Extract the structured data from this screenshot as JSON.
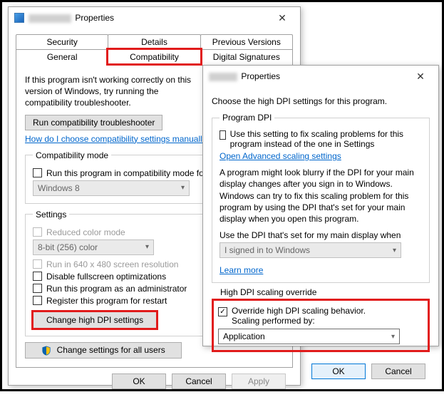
{
  "dlg1": {
    "title_suffix": "Properties",
    "tabs": {
      "security": "Security",
      "details": "Details",
      "previous_versions": "Previous Versions",
      "general": "General",
      "compatibility": "Compatibility",
      "digital_signatures": "Digital Signatures"
    },
    "intro": "If this program isn't working correctly on this version of Windows, try running the compatibility troubleshooter.",
    "run_troubleshooter": "Run compatibility troubleshooter",
    "manual_link": "How do I choose compatibility settings manually?",
    "compat_mode": {
      "legend": "Compatibility mode",
      "checkbox": "Run this program in compatibility mode for:",
      "select_value": "Windows 8"
    },
    "settings": {
      "legend": "Settings",
      "reduced_color": "Reduced color mode",
      "color_select": "8-bit (256) color",
      "run_640": "Run in 640 x 480 screen resolution",
      "disable_fullscreen": "Disable fullscreen optimizations",
      "run_admin": "Run this program as an administrator",
      "register_restart": "Register this program for restart",
      "change_dpi": "Change high DPI settings"
    },
    "change_all_users": "Change settings for all users",
    "actions": {
      "ok": "OK",
      "cancel": "Cancel",
      "apply": "Apply"
    }
  },
  "dlg2": {
    "title_suffix": "Properties",
    "intro": "Choose the high DPI settings for this program.",
    "program_dpi": {
      "legend": "Program DPI",
      "use_setting": "Use this setting to fix scaling problems for this program instead of the one in Settings",
      "open_advanced": "Open Advanced scaling settings",
      "blurb": "A program might look blurry if the DPI for your main display changes after you sign in to Windows. Windows can try to fix this scaling problem for this program by using the DPI that's set for your main display when you open this program.",
      "use_dpi_when": "Use the DPI that's set for my main display when",
      "when_select": "I signed in to Windows",
      "learn_more": "Learn more"
    },
    "override": {
      "legend": "High DPI scaling override",
      "check_line1": "Override high DPI scaling behavior.",
      "check_line2": "Scaling performed by:",
      "select_value": "Application"
    },
    "actions": {
      "ok": "OK",
      "cancel": "Cancel"
    }
  }
}
